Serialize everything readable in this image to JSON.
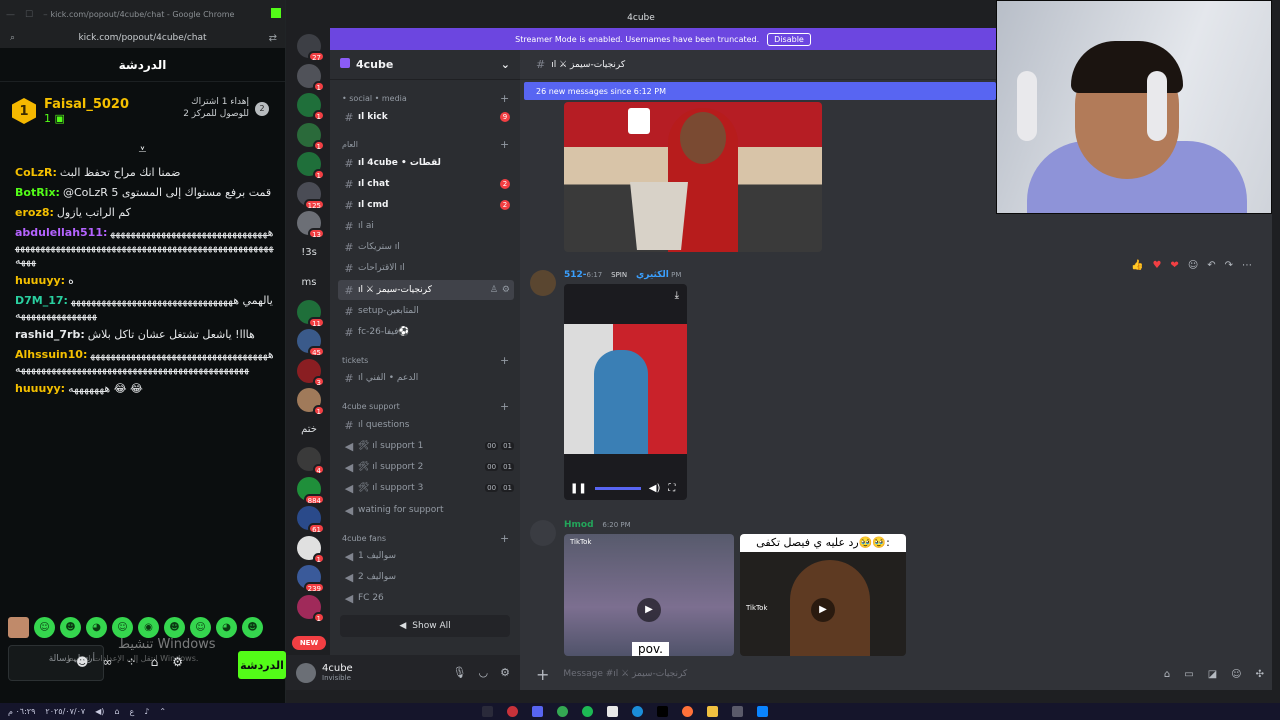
{
  "browser": {
    "window_title": "kick.com/popout/4cube/chat - Google Chrome",
    "url": "kick.com/popout/4cube/chat"
  },
  "kick": {
    "title": "الدردشة",
    "gift": {
      "rank": "1",
      "user": "Faisal_5020",
      "count": "1",
      "line1": "إهداء 1 اشتراك",
      "line2": "للوصول للمركز 2",
      "next_rank": "2"
    },
    "messages": [
      {
        "user": "CoLzR:",
        "color": "#f5c000",
        "text": "ضمنا انك مراح تحفظ البث"
      },
      {
        "user": "BotRix:",
        "color": "#53fc18",
        "text": "@CoLzR قمت برفع مستواك إلى المستوى 5"
      },
      {
        "user": "eroz8:",
        "color": "#f5c000",
        "text": "كم الراتب يازول"
      },
      {
        "user": "abdulellah511:",
        "color": "#b463ff",
        "text": "ههههههههههههههههههههههههههههههههههههههههههههههههههههههههههههههههههههههههههههههههههههههه"
      },
      {
        "user": "huuuyy:",
        "color": "#f5c000",
        "text": "ه"
      },
      {
        "user": "D7M_17:",
        "color": "#2ad0a0",
        "text": "يالهمي ههههههههههههههههههههههههههههههههههههههههههههههههه"
      },
      {
        "user": "rashid_7rb:",
        "color": "#e6e8ea",
        "text": "هااا! ياشعل تشتغل عشان تاكل بلاش"
      },
      {
        "user": "Alhssuin10:",
        "color": "#f5c000",
        "text": "هههههههههههههههههههههههههههههههههههههههههههههههههههههههههههههههههههههههههههههههههه"
      },
      {
        "user": "huuuyy:",
        "color": "#f5c000",
        "text": "هههههههه 😂 😂"
      }
    ],
    "input_placeholder": "أرسل رسالة",
    "send_label": "الدردشة",
    "watermark1": "تنشيط Windows",
    "watermark2": "انتقل إلى الإعدادات لتنشيط Windows."
  },
  "discord": {
    "window_title": "4cube",
    "streamer_banner": "Streamer Mode is enabled. Usernames have been truncated.",
    "disable_label": "Disable",
    "server_name": "4cube",
    "rail": [
      {
        "badge": "27"
      },
      {
        "badge": "1"
      },
      {
        "badge": "1"
      },
      {
        "badge": "1"
      },
      {
        "badge": "1"
      },
      {
        "badge": "125"
      },
      {
        "badge": "13"
      },
      {
        "label": "!3s"
      },
      {
        "label": "ms"
      },
      {
        "badge": "11"
      },
      {
        "badge": "45"
      },
      {
        "badge": "3"
      },
      {
        "badge": "1"
      },
      {
        "label": "ختم"
      },
      {
        "badge": "4"
      },
      {
        "badge": "884"
      },
      {
        "badge": "61"
      },
      {
        "badge": "1"
      },
      {
        "badge": "239"
      },
      {
        "badge": "1"
      }
    ],
    "new_label": "NEW",
    "categories": {
      "social": "• social • media",
      "general": "العام",
      "tickets": "tickets",
      "support": "4cube support",
      "fans": "4cube fans"
    },
    "channels": {
      "kick": "ıl kick",
      "kick_badge": "9",
      "cube": "ıl 4cube • لقطات",
      "chat": "ıl chat",
      "chat_badge": "2",
      "cmd": "ıl cmd",
      "cmd_badge": "2",
      "ai": "ıl ai",
      "streaks": "ستريكات ıl",
      "suggestions": "الاقتراحات ıl",
      "current": "ıl ⚔ كرنجيات-سيمز",
      "setup": "setup-المتابعين",
      "fc26": "fc-26-فيفا⚽",
      "support_tech": "ıl الدعم • الفني",
      "questions": "ıl questions",
      "support1": "🛠 ıl support 1",
      "support2": "🛠 ıl support 2",
      "support3": "🛠 ıl support 3",
      "waiting": "watinig for support",
      "fans1": "سواليف 1",
      "fans2": "سواليف 2",
      "fans3": "FC 26",
      "vc_a": "00",
      "vc_b": "01",
      "show_all": "Show All"
    },
    "user": {
      "name": "4cube",
      "status": "Invisible"
    },
    "chat": {
      "channel_title": "ıl ⚔ كرنجيات-سيمز",
      "new_messages": "26 new messages since 6:12 PM",
      "msg1_author": "512-الكثيري",
      "msg1_tag": "SPIN",
      "msg1_time": "6:17 PM",
      "msg2_author": "Hmod",
      "msg2_time": "6:20 PM",
      "tiktok1_label": "TikTok",
      "tiktok1_pov": "pov.",
      "tiktok2_caption": "رد عليه ي فيصل تكفى🥹🥹:",
      "tiktok2_label": "TikTok",
      "composer_placeholder": "Message #ıl ⚔ كرنجيات-سيمز"
    }
  },
  "taskbar": {
    "time": "٠٦:٢٩ م",
    "date": "٢٠٢٥/٠٧/٠٧",
    "lang": "ع"
  }
}
